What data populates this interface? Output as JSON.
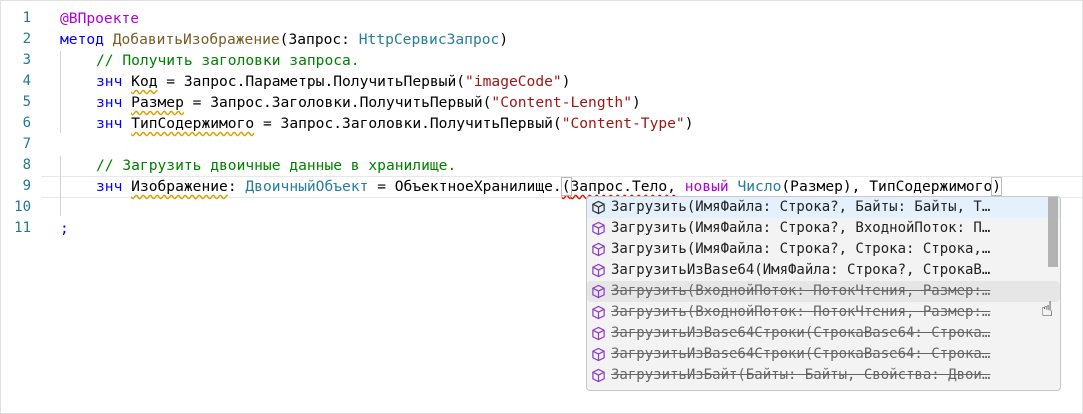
{
  "line_numbers": [
    "1",
    "2",
    "3",
    "4",
    "5",
    "6",
    "7",
    "8",
    "9",
    "10",
    "11"
  ],
  "code": {
    "l1": "@ВПроекте",
    "l2": {
      "kw": "метод",
      "name": "ДобавитьИзображение",
      "p1": "(Запрос: ",
      "type": "HttpСервисЗапрос",
      "p2": ")"
    },
    "l3": "// Получить заголовки запроса.",
    "l4": {
      "kw": "знч",
      "var": "Код",
      "rest": " = Запрос.Параметры.ПолучитьПервый(",
      "str": "\"imageCode\"",
      "end": ")"
    },
    "l5": {
      "kw": "знч",
      "var": "Размер",
      "rest": " = Запрос.Заголовки.ПолучитьПервый(",
      "str": "\"Content-Length\"",
      "end": ")"
    },
    "l6": {
      "kw": "знч",
      "var": "ТипСодержимого",
      "rest": " = Запрос.Заголовки.ПолучитьПервый(",
      "str": "\"Content-Type\"",
      "end": ")"
    },
    "l8": "// Загрузить двоичные данные в хранилище.",
    "l9": {
      "kw": "знч",
      "var": "Изображение",
      "colon": ": ",
      "type": "ДвоичныйОбъект",
      "mid": " = ОбъектноеХранилище.",
      "open": "(",
      "err": "Запрос.Тело,",
      "sp": " ",
      "new": "новый",
      "num": " Число",
      "args": "(Размер), ТипСодержимого",
      "close": ")"
    },
    "l11": ";"
  },
  "suggestions": [
    {
      "label": "Загрузить(ИмяФайла: Строка?, Байты: Байты, Т…",
      "deprecated": false
    },
    {
      "label": "Загрузить(ИмяФайла: Строка?, ВходнойПоток: П…",
      "deprecated": false
    },
    {
      "label": "Загрузить(ИмяФайла: Строка?, Строка: Строка,…",
      "deprecated": false
    },
    {
      "label": "ЗагрузитьИзBase64(ИмяФайла: Строка?, СтрокаВ…",
      "deprecated": false
    },
    {
      "label": "Загрузить(ВходнойПоток: ПотокЧтения, Размер:…",
      "deprecated": true
    },
    {
      "label": "Загрузить(ВходнойПоток: ПотокЧтения, Размер:…",
      "deprecated": true
    },
    {
      "label": "ЗагрузитьИзBase64Строки(СтрокаBase64: Строка…",
      "deprecated": true
    },
    {
      "label": "ЗагрузитьИзBase64Строки(СтрокаBase64: Строка…",
      "deprecated": true
    },
    {
      "label": "ЗагрузитьИзБайт(Байты: Байты, Свойства: Двои…",
      "deprecated": true
    }
  ],
  "icons": {
    "suggestion": "method-cube-icon",
    "cursor": "hand-pointer-icon"
  }
}
